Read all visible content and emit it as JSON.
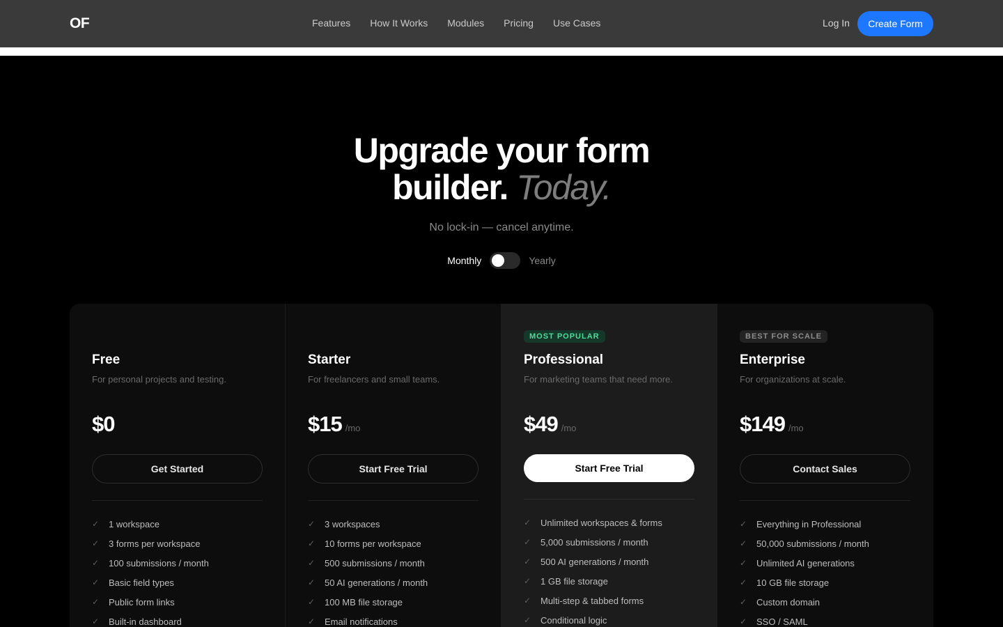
{
  "nav": {
    "logo": "OF",
    "links": [
      "Features",
      "How It Works",
      "Modules",
      "Pricing",
      "Use Cases"
    ],
    "login": "Log In",
    "cta": "Create Form"
  },
  "hero": {
    "title_line1": "Upgrade your form",
    "title_line2": "builder.",
    "title_accent": "Today.",
    "subtitle": "No lock-in — cancel anytime.",
    "billing_monthly": "Monthly",
    "billing_yearly": "Yearly",
    "billing_selected": "Monthly"
  },
  "plans": [
    {
      "badge": "",
      "name": "Free",
      "description": "For personal projects and testing.",
      "price": "$0",
      "period": "",
      "button": "Get Started",
      "features": [
        "1 workspace",
        "3 forms per workspace",
        "100 submissions / month",
        "Basic field types",
        "Public form links",
        "Built-in dashboard"
      ]
    },
    {
      "badge": "",
      "name": "Starter",
      "description": "For freelancers and small teams.",
      "price": "$15",
      "period": "/mo",
      "button": "Start Free Trial",
      "features": [
        "3 workspaces",
        "10 forms per workspace",
        "500 submissions / month",
        "50 AI generations / month",
        "100 MB file storage",
        "Email notifications"
      ]
    },
    {
      "badge": "MOST POPULAR",
      "name": "Professional",
      "description": "For marketing teams that need more.",
      "price": "$49",
      "period": "/mo",
      "button": "Start Free Trial",
      "features": [
        "Unlimited workspaces & forms",
        "5,000 submissions / month",
        "500 AI generations / month",
        "1 GB file storage",
        "Multi-step & tabbed forms",
        "Conditional logic"
      ]
    },
    {
      "badge": "BEST FOR SCALE",
      "name": "Enterprise",
      "description": "For organizations at scale.",
      "price": "$149",
      "period": "/mo",
      "button": "Contact Sales",
      "features": [
        "Everything in Professional",
        "50,000 submissions / month",
        "Unlimited AI generations",
        "10 GB file storage",
        "Custom domain",
        "SSO / SAML"
      ]
    }
  ],
  "colors": {
    "accent": "#1e78ff",
    "popular_badge": "#4ade9a",
    "background": "#000000",
    "nav_background": "#3a3a3a"
  }
}
